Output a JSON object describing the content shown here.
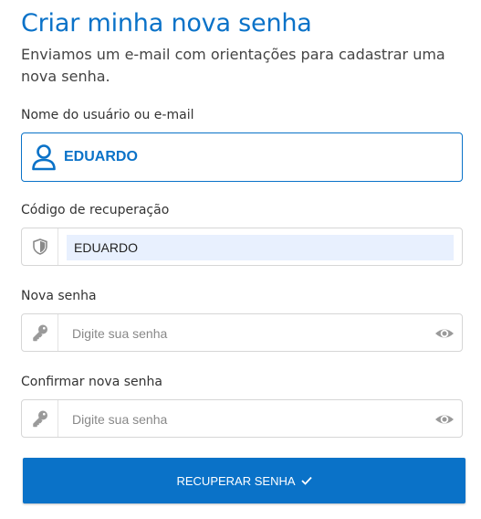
{
  "header": {
    "title": "Criar minha nova senha",
    "subtitle": "Enviamos um e-mail com orientações para cadastrar uma nova senha."
  },
  "fields": {
    "username": {
      "label": "Nome do usuário ou e-mail",
      "value": "EDUARDO",
      "icon": "user-icon"
    },
    "code": {
      "label": "Código de recuperação",
      "value": "EDUARDO",
      "icon": "shield-icon"
    },
    "new_password": {
      "label": "Nova senha",
      "placeholder": "Digite sua senha",
      "icon": "key-icon"
    },
    "confirm_password": {
      "label": "Confirmar nova senha",
      "placeholder": "Digite sua senha",
      "icon": "key-icon"
    }
  },
  "submit": {
    "label": "RECUPERAR SENHA",
    "icon": "check-icon"
  },
  "colors": {
    "accent": "#0a72c8",
    "autofill_bg": "#e8f0fe"
  }
}
